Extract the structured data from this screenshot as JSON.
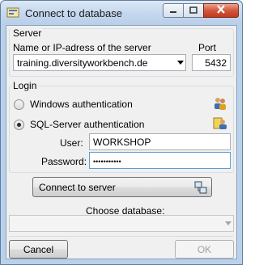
{
  "window": {
    "title": "Connect to database",
    "controls": {
      "minimize_icon": "minimize-icon",
      "maximize_icon": "maximize-icon",
      "close_icon": "close-icon"
    }
  },
  "server": {
    "group_label": "Server",
    "name_label": "Name or IP-adress of the server",
    "port_label": "Port",
    "server_value": "training.diversityworkbench.de",
    "port_value": "5432"
  },
  "login": {
    "group_label": "Login",
    "windows_auth_label": "Windows authentication",
    "sql_auth_label": "SQL-Server authentication",
    "selected": "sql",
    "user_label": "User:",
    "user_value": "WORKSHOP",
    "password_label": "Password:",
    "password_value": "•••••••••••"
  },
  "connect": {
    "button_label": "Connect to server",
    "choose_db_label": "Choose database:",
    "database_value": ""
  },
  "footer": {
    "cancel_label": "Cancel",
    "ok_label": "OK"
  },
  "colors": {
    "frame": "#b9d1ea",
    "client_bg": "#f0f0f0",
    "close_button": "#c23a1e"
  }
}
